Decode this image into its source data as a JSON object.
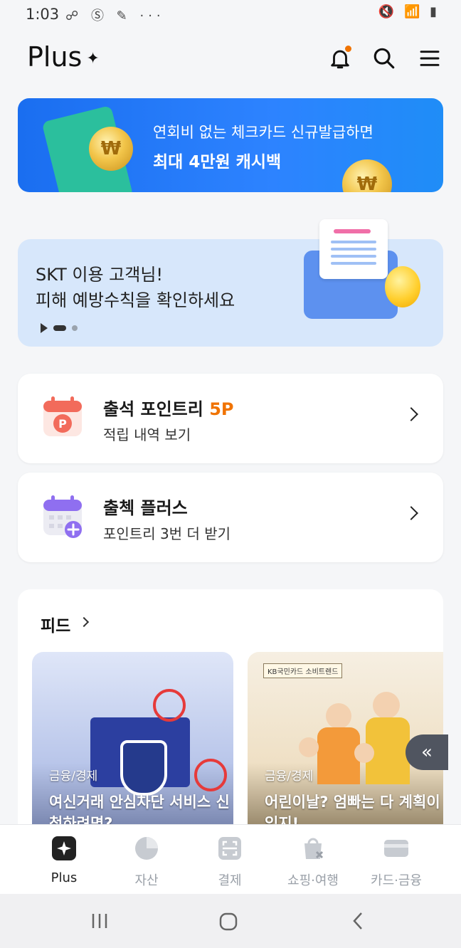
{
  "status_bar": {
    "time": "1:03",
    "left_icons": "☍ Ⓢ ✎ ···",
    "right_icons": "🔇 📶 ▮"
  },
  "header": {
    "logo": "Plus",
    "logo_spark": "✦"
  },
  "promo_banner": {
    "line1": "연회비 없는 체크카드 신규발급하면",
    "line2": "최대 4만원 캐시백"
  },
  "info_banner": {
    "line1": "SKT 이용 고객님!",
    "line2": "피해 예방수칙을 확인하세요"
  },
  "cards": [
    {
      "title": "출석 포인트리",
      "points": "5P",
      "subtitle": "적립 내역 보기"
    },
    {
      "title": "출첵 플러스",
      "points": "",
      "subtitle": "포인트리 3번 더 받기"
    }
  ],
  "feed": {
    "title": "피드",
    "items": [
      {
        "category": "금융/경제",
        "caption": "여신거래 안심차단 서비스 신청하려면?"
      },
      {
        "category": "금융/경제",
        "caption": "어린이날? 엄빠는 다 계획이 있지!",
        "badge": "KB국민카드 소비트렌드"
      }
    ],
    "float_button": "«"
  },
  "tabs": [
    {
      "label": "Plus",
      "active": true
    },
    {
      "label": "자산",
      "active": false
    },
    {
      "label": "결제",
      "active": false
    },
    {
      "label": "쇼핑·여행",
      "active": false
    },
    {
      "label": "카드·금융",
      "active": false
    }
  ],
  "colors": {
    "accent_orange": "#f07300",
    "banner_blue": "#1a6ef0",
    "info_bg": "#d7e7fb"
  }
}
